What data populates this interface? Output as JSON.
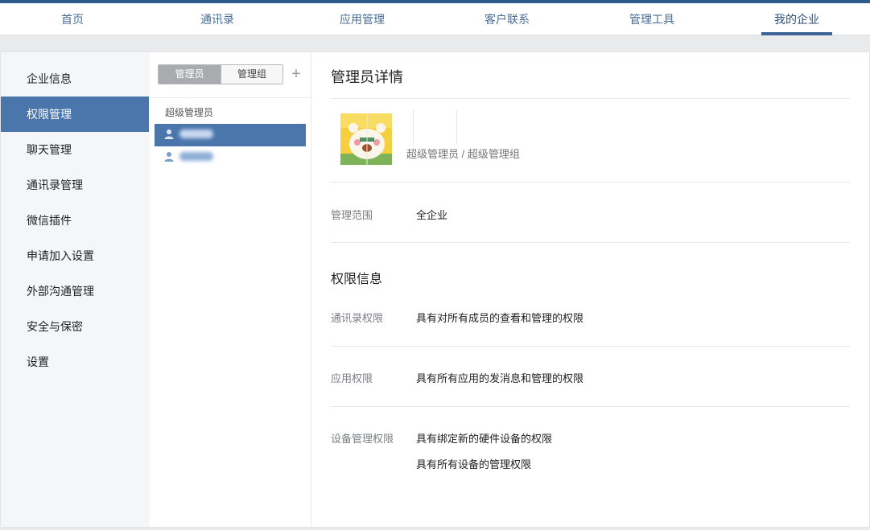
{
  "topnav": {
    "items": [
      "首页",
      "通讯录",
      "应用管理",
      "客户联系",
      "管理工具",
      "我的企业"
    ],
    "active_index": 5
  },
  "sidebar": {
    "items": [
      "企业信息",
      "权限管理",
      "聊天管理",
      "通讯录管理",
      "微信插件",
      "申请加入设置",
      "外部沟通管理",
      "安全与保密",
      "设置"
    ],
    "active_index": 1
  },
  "admin_list": {
    "tabs": [
      "管理员",
      "管理组"
    ],
    "active_tab": 0,
    "add_symbol": "+",
    "group_label": "超级管理员"
  },
  "detail": {
    "title": "管理员详情",
    "role": "超级管理员 / 超级管理组",
    "scope_label": "管理范围",
    "scope_value": "全企业",
    "permissions_title": "权限信息",
    "contacts_label": "通讯录权限",
    "contacts_value": "具有对所有成员的查看和管理的权限",
    "apps_label": "应用权限",
    "apps_value": "具有所有应用的发消息和管理的权限",
    "devices_label": "设备管理权限",
    "devices_value_1": "具有绑定新的硬件设备的权限",
    "devices_value_2": "具有所有设备的管理权限"
  },
  "colors": {
    "accent": "#4a76ab",
    "topbar": "#2f5a8c",
    "nav_text": "#4a6d96"
  },
  "icons": {
    "person": "person-icon",
    "add": "plus-icon",
    "avatar": "cartoon-avatar"
  }
}
